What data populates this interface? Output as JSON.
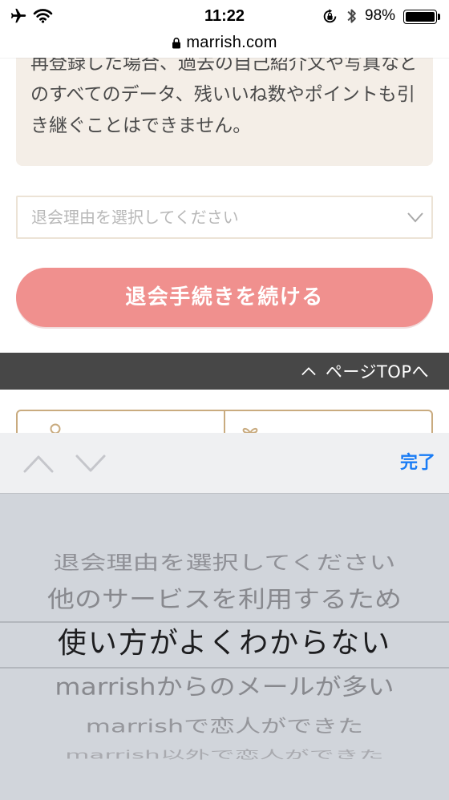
{
  "status_bar": {
    "time": "11:22",
    "battery_text": "98%",
    "battery_level": 0.98,
    "icons": {
      "airplane": "airplane-icon",
      "wifi": "wifi-icon",
      "rotation_lock": "rotation-lock-icon",
      "bluetooth": "bluetooth-icon",
      "battery": "battery-icon"
    }
  },
  "address_bar": {
    "domain": "marrish.com",
    "secure_icon": "lock-icon"
  },
  "notice": {
    "lines": [
      "再登録した場合、過去の自己紹介文や写真など",
      "のすべてのデータ、残いいね数やポイントも引",
      "き継ぐことはできません。"
    ]
  },
  "reason_select": {
    "value": "退会理由を選択してください",
    "icon": "chevron-down-icon"
  },
  "continue_button": {
    "label": "退会手続きを続ける"
  },
  "page_top": {
    "label": "ページTOPへ",
    "icon": "chevron-up-icon"
  },
  "footer_menu": {
    "icons": [
      "user-icon",
      "gift-icon"
    ]
  },
  "picker_toolbar": {
    "done_label": "完了",
    "prev_icon": "chevron-up-icon",
    "next_icon": "chevron-down-icon"
  },
  "picker": {
    "selected_index": 2,
    "options": [
      "退会理由を選択してください",
      "他のサービスを利用するため",
      "使い方がよくわからない",
      "marrishからのメールが多い",
      "marrishで恋人ができた",
      "marrish以外で恋人ができた"
    ]
  },
  "colors": {
    "notice_bg": "#f4eee7",
    "select_border": "#ece3d6",
    "button_pink": "#f0908e",
    "page_top_bar": "#474747",
    "footer_border": "#c9ab7f",
    "done_blue": "#1a7cf5",
    "picker_bg": "#d1d5db",
    "toolbar_bg": "#eff0f2"
  }
}
